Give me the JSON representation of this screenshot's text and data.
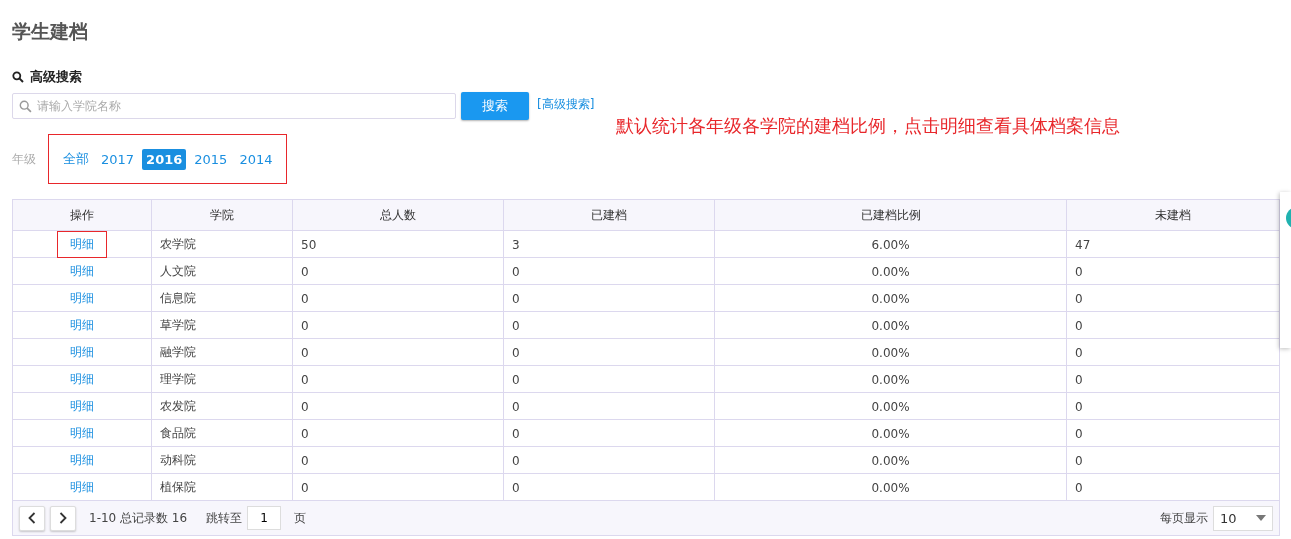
{
  "title": "学生建档",
  "search": {
    "title": "高级搜索",
    "placeholder": "请输入学院名称",
    "button": "搜索",
    "advanced_link": "[高级搜索]"
  },
  "grade_filter": {
    "label": "年级",
    "annotated": true,
    "options": [
      {
        "label": "全部",
        "selected": false
      },
      {
        "label": "2017",
        "selected": false
      },
      {
        "label": "2016",
        "selected": true
      },
      {
        "label": "2015",
        "selected": false
      },
      {
        "label": "2014",
        "selected": false
      }
    ]
  },
  "note": "默认统计各年级各学院的建档比例，点击明细查看具体档案信息",
  "table": {
    "columns": [
      "操作",
      "学院",
      "总人数",
      "已建档",
      "已建档比例",
      "未建档"
    ],
    "rows": [
      {
        "action": "明细",
        "annotated": true,
        "college": "农学院",
        "total": "50",
        "archived": "3",
        "ratio": "6.00%",
        "unarchived": "47"
      },
      {
        "action": "明细",
        "annotated": false,
        "college": "人文院",
        "total": "0",
        "archived": "0",
        "ratio": "0.00%",
        "unarchived": "0"
      },
      {
        "action": "明细",
        "annotated": false,
        "college": "信息院",
        "total": "0",
        "archived": "0",
        "ratio": "0.00%",
        "unarchived": "0"
      },
      {
        "action": "明细",
        "annotated": false,
        "college": "草学院",
        "total": "0",
        "archived": "0",
        "ratio": "0.00%",
        "unarchived": "0"
      },
      {
        "action": "明细",
        "annotated": false,
        "college": "融学院",
        "total": "0",
        "archived": "0",
        "ratio": "0.00%",
        "unarchived": "0"
      },
      {
        "action": "明细",
        "annotated": false,
        "college": "理学院",
        "total": "0",
        "archived": "0",
        "ratio": "0.00%",
        "unarchived": "0"
      },
      {
        "action": "明细",
        "annotated": false,
        "college": "农发院",
        "total": "0",
        "archived": "0",
        "ratio": "0.00%",
        "unarchived": "0"
      },
      {
        "action": "明细",
        "annotated": false,
        "college": "食品院",
        "total": "0",
        "archived": "0",
        "ratio": "0.00%",
        "unarchived": "0"
      },
      {
        "action": "明细",
        "annotated": false,
        "college": "动科院",
        "total": "0",
        "archived": "0",
        "ratio": "0.00%",
        "unarchived": "0"
      },
      {
        "action": "明细",
        "annotated": false,
        "college": "植保院",
        "total": "0",
        "archived": "0",
        "ratio": "0.00%",
        "unarchived": "0"
      }
    ]
  },
  "pagination": {
    "range": "1-10 总记录数 16",
    "jump_label": "跳转至",
    "page": "1",
    "page_suffix": "页",
    "per_page_label": "每页显示",
    "per_page": "10"
  }
}
